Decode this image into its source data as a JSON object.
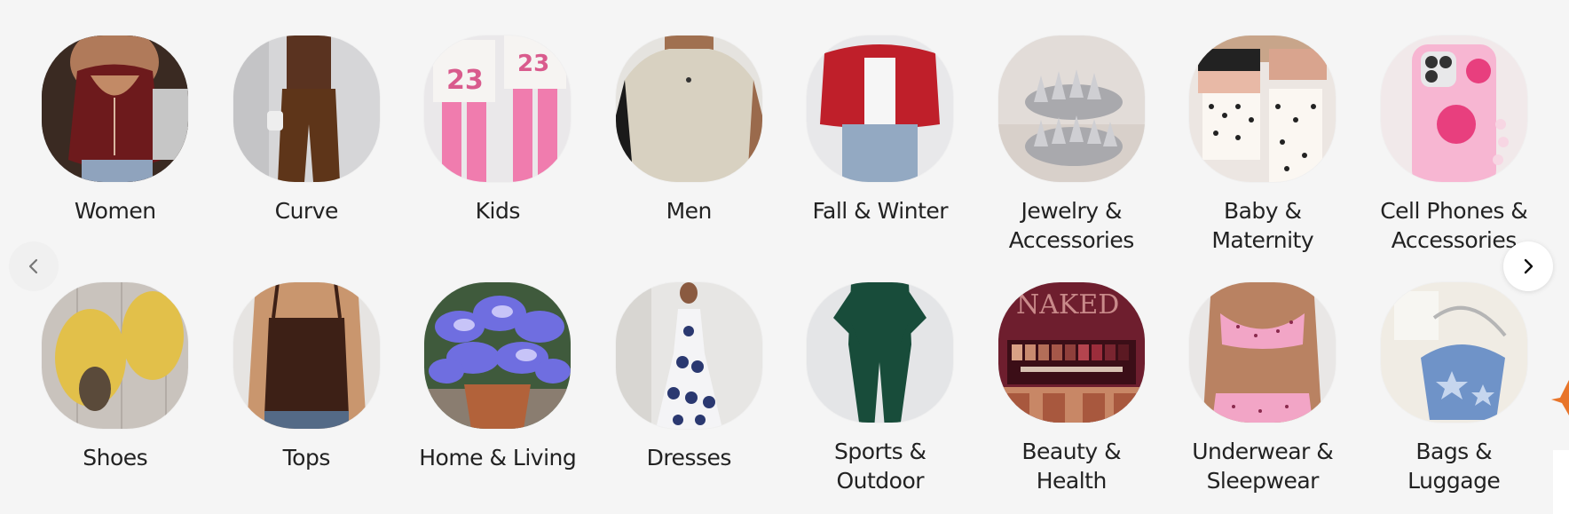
{
  "categories": [
    {
      "label": "Women",
      "image": "women-leather-top"
    },
    {
      "label": "Curve",
      "image": "curve-brown-outfit"
    },
    {
      "label": "Kids",
      "image": "kids-jersey-pink"
    },
    {
      "label": "Men",
      "image": "men-polo-beige"
    },
    {
      "label": "Fall & Winter",
      "image": "red-cardigan"
    },
    {
      "label": "Jewelry &\nAccessories",
      "image": "spike-bracelets"
    },
    {
      "label": "Baby &\nMaternity",
      "image": "baby-clothes-stack"
    },
    {
      "label": "Cell Phones &\nAccessories",
      "image": "pink-phone-case"
    },
    {
      "label": "Shoes",
      "image": "yellow-slippers"
    },
    {
      "label": "Tops",
      "image": "brown-tank-top"
    },
    {
      "label": "Home & Living",
      "image": "blue-butterfly-plant"
    },
    {
      "label": "Dresses",
      "image": "printed-maxi-dress"
    },
    {
      "label": "Sports &\nOutdoor",
      "image": "green-jumpsuit"
    },
    {
      "label": "Beauty &\nHealth",
      "image": "eyeshadow-palette",
      "palette_text": "NAKED"
    },
    {
      "label": "Underwear &\nSleepwear",
      "image": "pink-polka-set"
    },
    {
      "label": "Bags &\nLuggage",
      "image": "denim-star-bag"
    }
  ],
  "nav": {
    "prev_icon": "chevron-left-icon",
    "next_icon": "chevron-right-icon"
  },
  "colors": {
    "background": "#f5f5f5",
    "text": "#222222"
  }
}
